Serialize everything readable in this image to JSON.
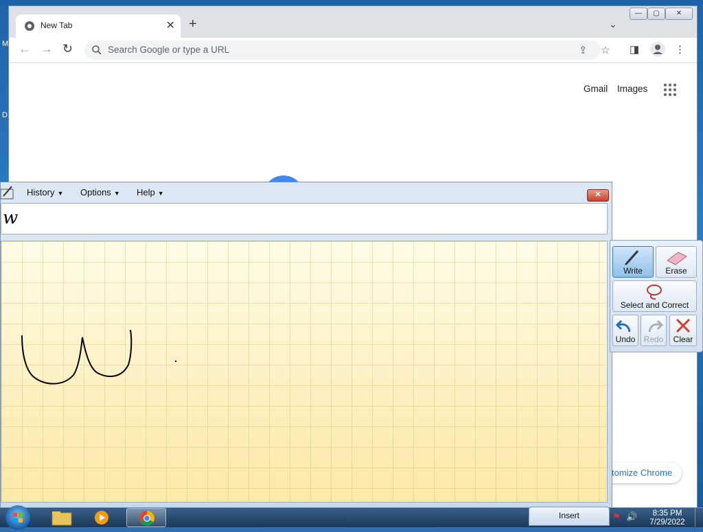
{
  "desktop": {
    "edge_glyphs": [
      "M",
      "D"
    ]
  },
  "browser": {
    "tab": {
      "title": "New Tab",
      "close": "✕"
    },
    "new_tab": "+",
    "tab_list": "⌄",
    "caption": {
      "minimize": "—",
      "maximize": "▢",
      "close": "✕"
    },
    "toolbar": {
      "back": "←",
      "forward": "→",
      "reload": "↻",
      "omnibox_placeholder": "Search Google or type a URL",
      "share": "⇪",
      "bookmark": "☆",
      "side_panel": "◨",
      "menu": "⋮"
    },
    "ntp": {
      "gmail": "Gmail",
      "images": "Images",
      "customize": "tomize Chrome"
    }
  },
  "tip": {
    "menus": [
      {
        "label": "History"
      },
      {
        "label": "Options"
      },
      {
        "label": "Help"
      }
    ],
    "menu_arrow": "▼",
    "close": "✕",
    "recognized_text": "w"
  },
  "tools": {
    "write": "Write",
    "erase": "Erase",
    "select_correct": "Select and Correct",
    "undo": "Undo",
    "redo": "Redo",
    "clear": "Clear"
  },
  "taskbar": {
    "insert": "Insert",
    "time": "8:35 PM",
    "date": "7/29/2022",
    "volume_icon": "🔊",
    "flag_icon": "⚑"
  },
  "colors": {
    "accent": "#1a73e8",
    "pad": "#fdf3c4",
    "ink": "#000000"
  }
}
